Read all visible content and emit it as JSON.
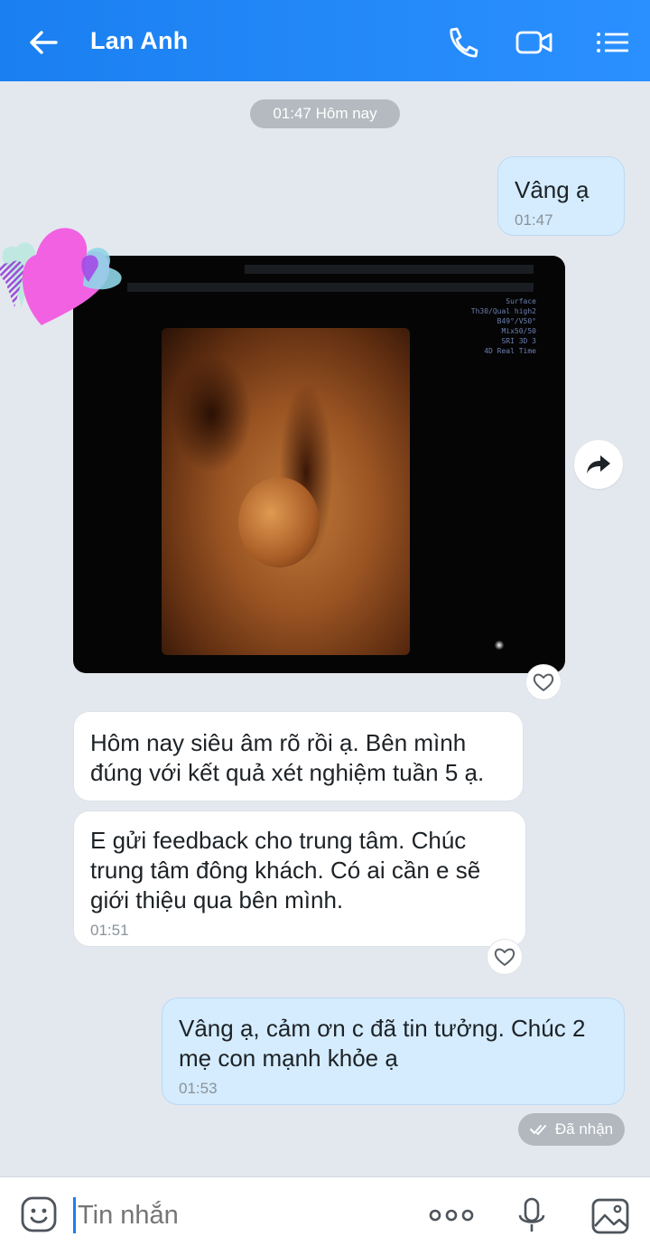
{
  "header": {
    "title": "Lan Anh",
    "icons": [
      "back-arrow-icon",
      "phone-icon",
      "video-call-icon",
      "menu-list-icon"
    ]
  },
  "time_chip": "01:47 Hôm nay",
  "messages": [
    {
      "id": "m1",
      "direction": "out",
      "text": "Vâng ạ",
      "time": "01:47"
    },
    {
      "id": "m2",
      "direction": "in",
      "type": "image",
      "sticker": "hearts-sticker"
    },
    {
      "id": "m3",
      "direction": "in",
      "text": "Hôm nay siêu âm rõ rồi ạ. Bên mình đúng với kết quả xét nghiệm tuần 5 ạ."
    },
    {
      "id": "m4",
      "direction": "in",
      "text": "E gửi feedback cho trung tâm. Chúc trung tâm đông khách. Có ai cần e sẽ giới thiệu qua bên mình.",
      "time": "01:51"
    },
    {
      "id": "m5",
      "direction": "out",
      "text": "Vâng ạ, cảm ơn c đã tin tưởng. Chúc 2 mẹ con mạnh khỏe ạ",
      "time": "01:53"
    }
  ],
  "ultrasound_overlay": [
    "Surface",
    "Th30/Qual high2",
    "B49°/V50°",
    "Mix50/50",
    "SRI 3D 3",
    "4D Real Time"
  ],
  "status": "Đã nhận",
  "composer": {
    "placeholder": "Tin nhắn"
  },
  "colors": {
    "header": "#1a7ff0",
    "out_bubble": "#d4ecfe",
    "in_bubble": "#ffffff",
    "background": "#e3e8ef"
  }
}
